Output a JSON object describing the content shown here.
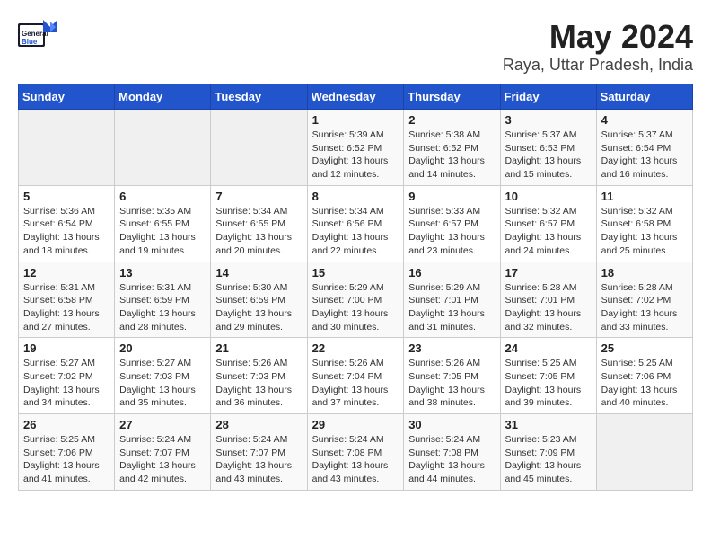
{
  "header": {
    "logo_general": "General",
    "logo_blue": "Blue",
    "title": "May 2024",
    "subtitle": "Raya, Uttar Pradesh, India"
  },
  "weekdays": [
    "Sunday",
    "Monday",
    "Tuesday",
    "Wednesday",
    "Thursday",
    "Friday",
    "Saturday"
  ],
  "weeks": [
    [
      {
        "day": "",
        "info": ""
      },
      {
        "day": "",
        "info": ""
      },
      {
        "day": "",
        "info": ""
      },
      {
        "day": "1",
        "info": "Sunrise: 5:39 AM\nSunset: 6:52 PM\nDaylight: 13 hours\nand 12 minutes."
      },
      {
        "day": "2",
        "info": "Sunrise: 5:38 AM\nSunset: 6:52 PM\nDaylight: 13 hours\nand 14 minutes."
      },
      {
        "day": "3",
        "info": "Sunrise: 5:37 AM\nSunset: 6:53 PM\nDaylight: 13 hours\nand 15 minutes."
      },
      {
        "day": "4",
        "info": "Sunrise: 5:37 AM\nSunset: 6:54 PM\nDaylight: 13 hours\nand 16 minutes."
      }
    ],
    [
      {
        "day": "5",
        "info": "Sunrise: 5:36 AM\nSunset: 6:54 PM\nDaylight: 13 hours\nand 18 minutes."
      },
      {
        "day": "6",
        "info": "Sunrise: 5:35 AM\nSunset: 6:55 PM\nDaylight: 13 hours\nand 19 minutes."
      },
      {
        "day": "7",
        "info": "Sunrise: 5:34 AM\nSunset: 6:55 PM\nDaylight: 13 hours\nand 20 minutes."
      },
      {
        "day": "8",
        "info": "Sunrise: 5:34 AM\nSunset: 6:56 PM\nDaylight: 13 hours\nand 22 minutes."
      },
      {
        "day": "9",
        "info": "Sunrise: 5:33 AM\nSunset: 6:57 PM\nDaylight: 13 hours\nand 23 minutes."
      },
      {
        "day": "10",
        "info": "Sunrise: 5:32 AM\nSunset: 6:57 PM\nDaylight: 13 hours\nand 24 minutes."
      },
      {
        "day": "11",
        "info": "Sunrise: 5:32 AM\nSunset: 6:58 PM\nDaylight: 13 hours\nand 25 minutes."
      }
    ],
    [
      {
        "day": "12",
        "info": "Sunrise: 5:31 AM\nSunset: 6:58 PM\nDaylight: 13 hours\nand 27 minutes."
      },
      {
        "day": "13",
        "info": "Sunrise: 5:31 AM\nSunset: 6:59 PM\nDaylight: 13 hours\nand 28 minutes."
      },
      {
        "day": "14",
        "info": "Sunrise: 5:30 AM\nSunset: 6:59 PM\nDaylight: 13 hours\nand 29 minutes."
      },
      {
        "day": "15",
        "info": "Sunrise: 5:29 AM\nSunset: 7:00 PM\nDaylight: 13 hours\nand 30 minutes."
      },
      {
        "day": "16",
        "info": "Sunrise: 5:29 AM\nSunset: 7:01 PM\nDaylight: 13 hours\nand 31 minutes."
      },
      {
        "day": "17",
        "info": "Sunrise: 5:28 AM\nSunset: 7:01 PM\nDaylight: 13 hours\nand 32 minutes."
      },
      {
        "day": "18",
        "info": "Sunrise: 5:28 AM\nSunset: 7:02 PM\nDaylight: 13 hours\nand 33 minutes."
      }
    ],
    [
      {
        "day": "19",
        "info": "Sunrise: 5:27 AM\nSunset: 7:02 PM\nDaylight: 13 hours\nand 34 minutes."
      },
      {
        "day": "20",
        "info": "Sunrise: 5:27 AM\nSunset: 7:03 PM\nDaylight: 13 hours\nand 35 minutes."
      },
      {
        "day": "21",
        "info": "Sunrise: 5:26 AM\nSunset: 7:03 PM\nDaylight: 13 hours\nand 36 minutes."
      },
      {
        "day": "22",
        "info": "Sunrise: 5:26 AM\nSunset: 7:04 PM\nDaylight: 13 hours\nand 37 minutes."
      },
      {
        "day": "23",
        "info": "Sunrise: 5:26 AM\nSunset: 7:05 PM\nDaylight: 13 hours\nand 38 minutes."
      },
      {
        "day": "24",
        "info": "Sunrise: 5:25 AM\nSunset: 7:05 PM\nDaylight: 13 hours\nand 39 minutes."
      },
      {
        "day": "25",
        "info": "Sunrise: 5:25 AM\nSunset: 7:06 PM\nDaylight: 13 hours\nand 40 minutes."
      }
    ],
    [
      {
        "day": "26",
        "info": "Sunrise: 5:25 AM\nSunset: 7:06 PM\nDaylight: 13 hours\nand 41 minutes."
      },
      {
        "day": "27",
        "info": "Sunrise: 5:24 AM\nSunset: 7:07 PM\nDaylight: 13 hours\nand 42 minutes."
      },
      {
        "day": "28",
        "info": "Sunrise: 5:24 AM\nSunset: 7:07 PM\nDaylight: 13 hours\nand 43 minutes."
      },
      {
        "day": "29",
        "info": "Sunrise: 5:24 AM\nSunset: 7:08 PM\nDaylight: 13 hours\nand 43 minutes."
      },
      {
        "day": "30",
        "info": "Sunrise: 5:24 AM\nSunset: 7:08 PM\nDaylight: 13 hours\nand 44 minutes."
      },
      {
        "day": "31",
        "info": "Sunrise: 5:23 AM\nSunset: 7:09 PM\nDaylight: 13 hours\nand 45 minutes."
      },
      {
        "day": "",
        "info": ""
      }
    ]
  ]
}
